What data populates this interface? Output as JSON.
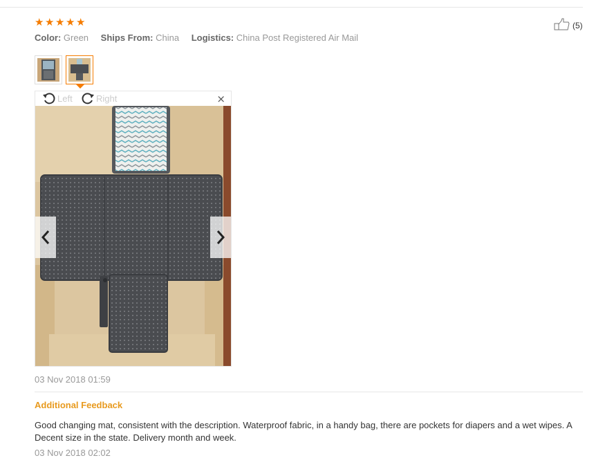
{
  "review": {
    "rating": 5,
    "stars": [
      "★",
      "★",
      "★",
      "★",
      "★"
    ],
    "color_label": "Color:",
    "color_value": "Green",
    "ships_label": "Ships From:",
    "ships_value": "China",
    "logistics_label": "Logistics:",
    "logistics_value": "China Post Registered Air Mail",
    "helpful_count": "(5)",
    "viewer": {
      "rotate_left": "Left",
      "rotate_right": "Right",
      "close": "×"
    },
    "date": "03 Nov 2018 01:59",
    "additional_heading": "Additional Feedback",
    "additional_text": "Good changing mat, consistent with the description. Waterproof fabric, in a handy bag, there are pockets for diapers and a wet wipes. A Decent size in the state. Delivery month and week.",
    "additional_date": "03 Nov 2018 02:02"
  },
  "colors": {
    "accent": "#f57c00",
    "feedback_heading": "#e89a1e"
  },
  "icons": [
    "star-icon",
    "thumbs-up-icon",
    "rotate-left-icon",
    "rotate-right-icon",
    "close-icon",
    "chevron-left-icon",
    "chevron-right-icon"
  ]
}
